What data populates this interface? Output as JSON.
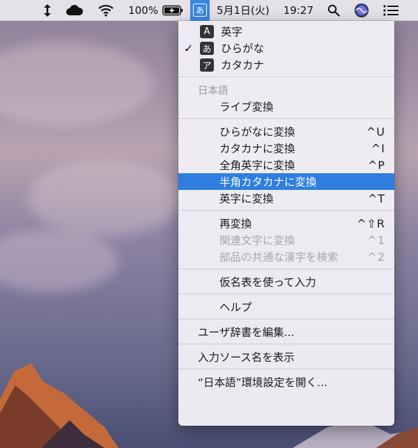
{
  "menubar": {
    "battery_percent": "100%",
    "input_source_glyph": "あ",
    "date": "5月1日(火)",
    "time": "19:27",
    "icons": [
      "sort-arrows-icon",
      "cloud-icon",
      "wifi-icon",
      "battery-charging-icon",
      "input-source-icon",
      "spotlight-search-icon",
      "siri-icon",
      "notification-center-icon"
    ]
  },
  "menu": {
    "modes": [
      {
        "icon": "A",
        "label": "英字",
        "checked": false
      },
      {
        "icon": "あ",
        "label": "ひらがな",
        "checked": true
      },
      {
        "icon": "ア",
        "label": "カタカナ",
        "checked": false
      }
    ],
    "checkmark": "✓",
    "section_title": "日本語",
    "live_convert": "ライブ変換",
    "convert_items": [
      {
        "label": "ひらがなに変換",
        "shortcut": "^U"
      },
      {
        "label": "カタカナに変換",
        "shortcut": "^I"
      },
      {
        "label": "全角英字に変換",
        "shortcut": "^P"
      },
      {
        "label": "半角カタカナに変換",
        "shortcut": ""
      },
      {
        "label": "英字に変換",
        "shortcut": "^T"
      }
    ],
    "reconvert_items": [
      {
        "label": "再変換",
        "shortcut": "^⇧R"
      },
      {
        "label": "関連文字に変換",
        "shortcut": "^1"
      },
      {
        "label": "部品の共通な漢字を検索",
        "shortcut": "^2"
      }
    ],
    "kana_table": "仮名表を使って入力",
    "help": "ヘルプ",
    "edit_dictionary": "ユーザ辞書を編集...",
    "show_source_name": "入力ソース名を表示",
    "open_preferences": "“日本語”環境設定を開く..."
  },
  "colors": {
    "highlight": "#2f7ee0",
    "input_source_bg": "#3b87e3",
    "disabled_text": "#a8a6ac"
  }
}
